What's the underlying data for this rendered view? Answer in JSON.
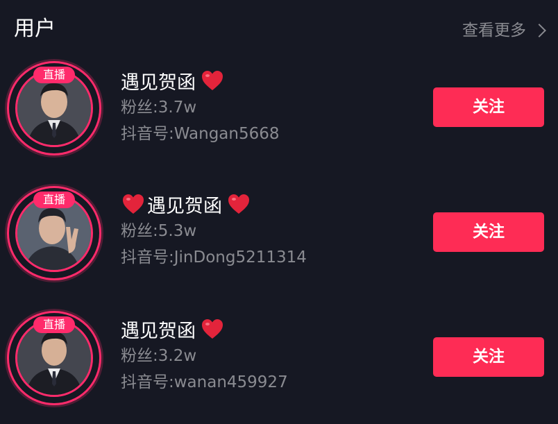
{
  "header": {
    "title": "用户",
    "more_label": "查看更多"
  },
  "colors": {
    "background": "#161823",
    "accent": "#fe2c55",
    "secondary_text": "#8a8b91"
  },
  "users": [
    {
      "name": "遇见贺函",
      "heart_before": false,
      "heart_after": true,
      "live_label": "直播",
      "fans": "粉丝:3.7w",
      "douyin_id": "抖音号:Wangan5668",
      "follow_label": "关注"
    },
    {
      "name": "遇见贺函",
      "heart_before": true,
      "heart_after": true,
      "live_label": "直播",
      "fans": "粉丝:5.3w",
      "douyin_id": "抖音号:JinDong5211314",
      "follow_label": "关注"
    },
    {
      "name": "遇见贺函",
      "heart_before": false,
      "heart_after": true,
      "live_label": "直播",
      "fans": "粉丝:3.2w",
      "douyin_id": "抖音号:wanan459927",
      "follow_label": "关注"
    }
  ]
}
